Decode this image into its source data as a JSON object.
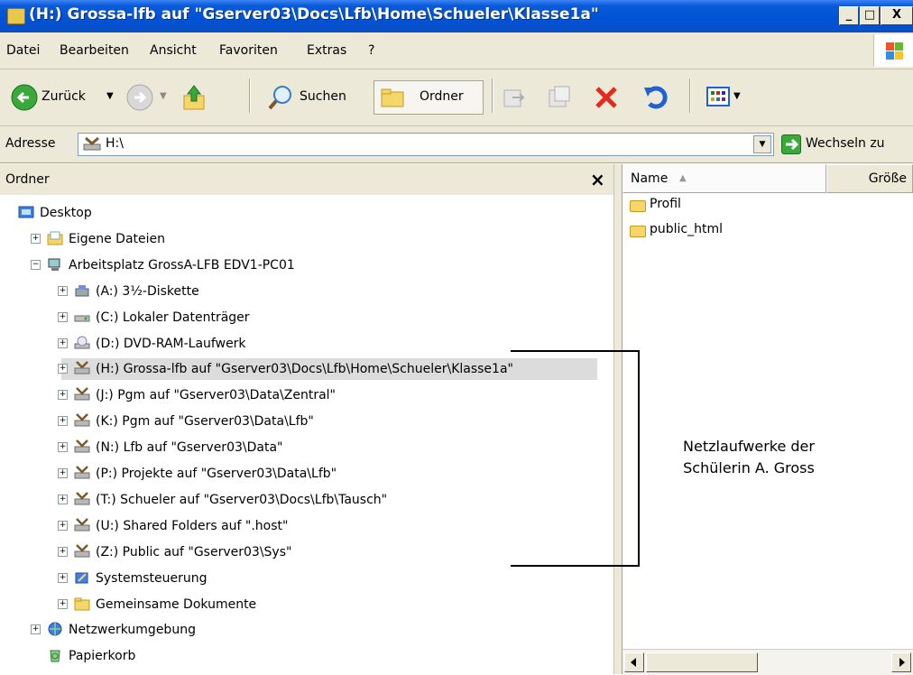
{
  "window": {
    "title": "(H:) Grossa-lfb auf \"Gserver03\\Docs\\Lfb\\Home\\Schueler\\Klasse1a\"",
    "title_icon": "network-drive-icon",
    "minimize": "_",
    "maximize": "□",
    "close": "X"
  },
  "menu": [
    "Datei",
    "Bearbeiten",
    "Ansicht",
    "Favoriten",
    "Extras",
    "?"
  ],
  "toolbar": {
    "back_label": "Zurück",
    "search_label": "Suchen",
    "folders_label": "Ordner"
  },
  "address": {
    "label": "Adresse",
    "value": "H:\\",
    "go_label": "Wechseln zu"
  },
  "folder_pane": {
    "title": "Ordner",
    "close": "×",
    "tree": [
      {
        "label": "Desktop",
        "icon": "desktop-icon",
        "level": 0,
        "expander": ""
      },
      {
        "label": "Eigene Dateien",
        "icon": "my-documents-icon",
        "level": 1,
        "expander": "+"
      },
      {
        "label": "Arbeitsplatz GrossA-LFB EDV1-PC01",
        "icon": "my-computer-icon",
        "level": 1,
        "expander": "−"
      },
      {
        "label": "(A:) 3½-Diskette",
        "icon": "floppy-drive-icon",
        "level": 2,
        "expander": "+"
      },
      {
        "label": "(C:) Lokaler Datenträger",
        "icon": "hard-disk-icon",
        "level": 2,
        "expander": "+"
      },
      {
        "label": "(D:) DVD-RAM-Laufwerk",
        "icon": "dvd-drive-icon",
        "level": 2,
        "expander": "+"
      },
      {
        "label": "(H:) Grossa-lfb auf \"Gserver03\\Docs\\Lfb\\Home\\Schueler\\Klasse1a\"",
        "icon": "network-drive-icon",
        "level": 2,
        "expander": "+",
        "selected": true
      },
      {
        "label": "(J:) Pgm auf \"Gserver03\\Data\\Zentral\"",
        "icon": "network-drive-icon",
        "level": 2,
        "expander": "+"
      },
      {
        "label": "(K:) Pgm auf \"Gserver03\\Data\\Lfb\"",
        "icon": "network-drive-icon",
        "level": 2,
        "expander": "+"
      },
      {
        "label": "(N:) Lfb auf \"Gserver03\\Data\"",
        "icon": "network-drive-icon",
        "level": 2,
        "expander": "+"
      },
      {
        "label": "(P:) Projekte auf \"Gserver03\\Data\\Lfb\"",
        "icon": "network-drive-icon",
        "level": 2,
        "expander": "+"
      },
      {
        "label": "(T:) Schueler auf \"Gserver03\\Docs\\Lfb\\Tausch\"",
        "icon": "network-drive-icon",
        "level": 2,
        "expander": "+"
      },
      {
        "label": "(U:) Shared Folders auf \".host\"",
        "icon": "network-drive-icon",
        "level": 2,
        "expander": "+"
      },
      {
        "label": "(Z:) Public auf \"Gserver03\\Sys\"",
        "icon": "network-drive-icon",
        "level": 2,
        "expander": "+"
      },
      {
        "label": "Systemsteuerung",
        "icon": "control-panel-icon",
        "level": 2,
        "expander": "+"
      },
      {
        "label": "Gemeinsame Dokumente",
        "icon": "folder-icon",
        "level": 2,
        "expander": "+"
      },
      {
        "label": "Netzwerkumgebung",
        "icon": "network-places-icon",
        "level": 1,
        "expander": "+"
      },
      {
        "label": "Papierkorb",
        "icon": "recycle-bin-icon",
        "level": 1,
        "expander": ""
      }
    ]
  },
  "file_pane": {
    "columns": [
      "Name",
      "Größe"
    ],
    "sort_indicator": "▲",
    "items": [
      "Profil",
      "public_html"
    ]
  },
  "annotation": {
    "line1": "Netzlaufwerke der",
    "line2": "Schülerin A. Gross"
  },
  "colors": {
    "titlebar": "#0052d6",
    "chrome": "#ece9d8",
    "selection": "#dcdcdc",
    "folder": "#f5d66a"
  }
}
